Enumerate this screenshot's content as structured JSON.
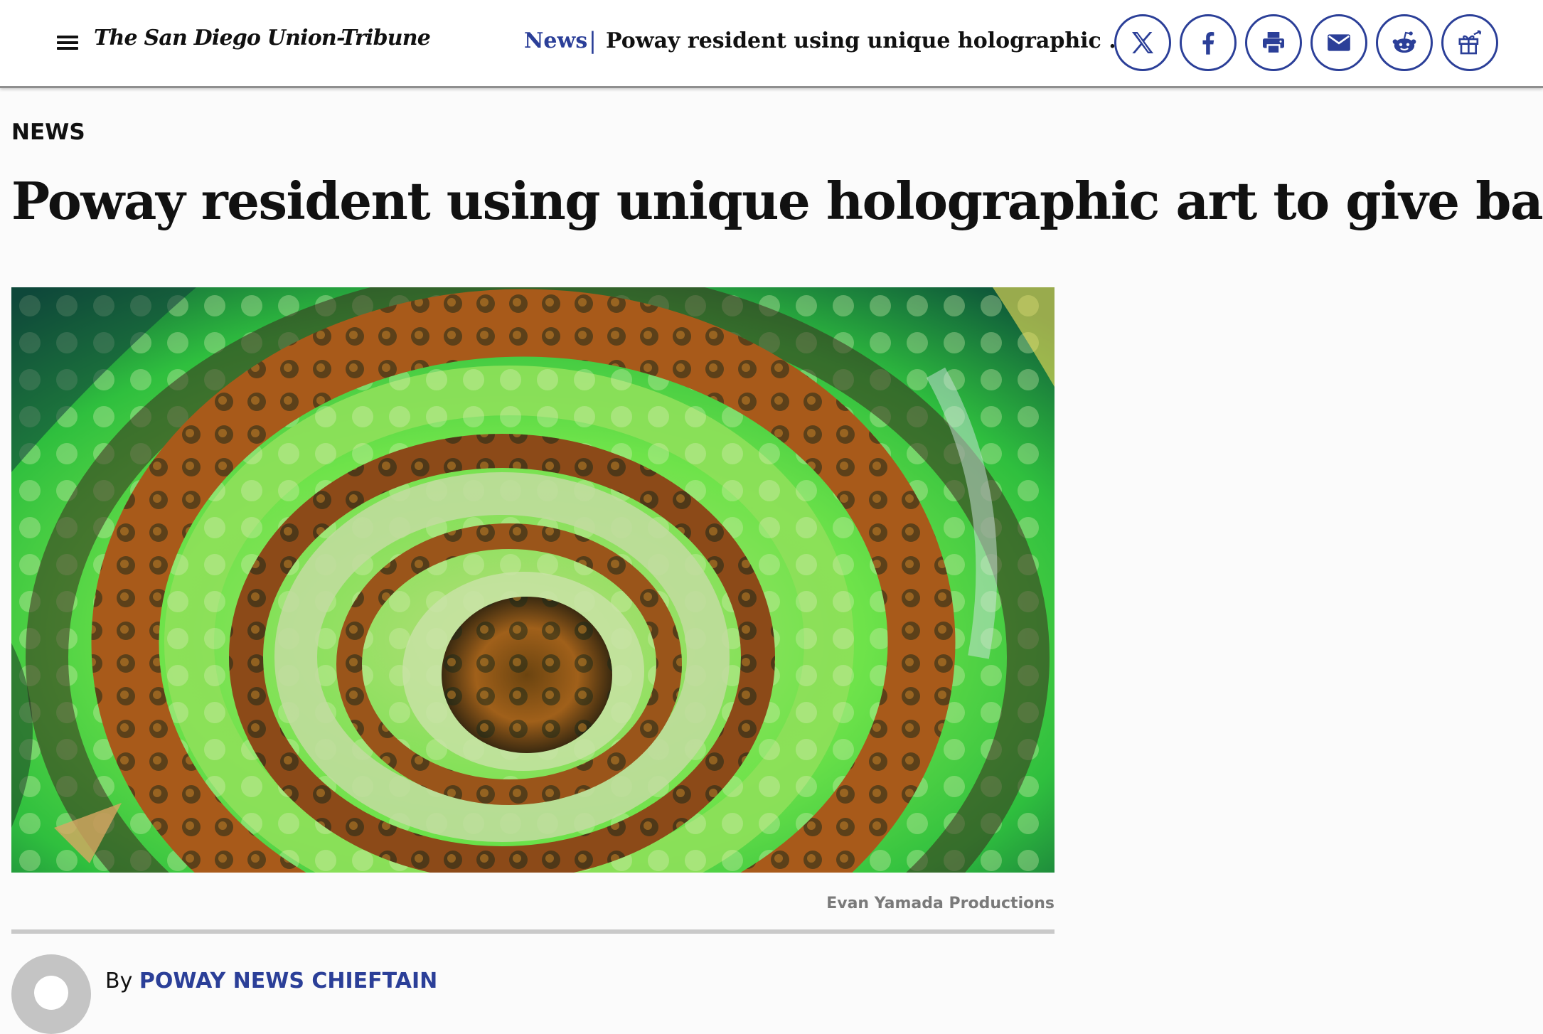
{
  "header": {
    "logo_text": "The San Diego Union-Tribune",
    "section_label": "News",
    "separator": "|",
    "article_title": "Poway resident using unique holographic art to give back",
    "share_buttons": [
      {
        "name": "x-share",
        "icon": "x-logo-icon"
      },
      {
        "name": "facebook-share",
        "icon": "facebook-icon"
      },
      {
        "name": "print",
        "icon": "printer-icon"
      },
      {
        "name": "email-share",
        "icon": "envelope-icon"
      },
      {
        "name": "reddit-share",
        "icon": "reddit-icon"
      },
      {
        "name": "gift-article",
        "icon": "gift-icon"
      }
    ]
  },
  "article": {
    "kicker": "NEWS",
    "headline": "Poway resident using unique holographic art to give back",
    "image_credit": "Evan Yamada Productions",
    "byline_prefix": "By",
    "author": "POWAY NEWS CHIEFTAIN"
  },
  "colors": {
    "accent": "#2b3f98",
    "text": "#111111",
    "muted": "#7a7a7a",
    "divider": "#c9c9c9"
  }
}
